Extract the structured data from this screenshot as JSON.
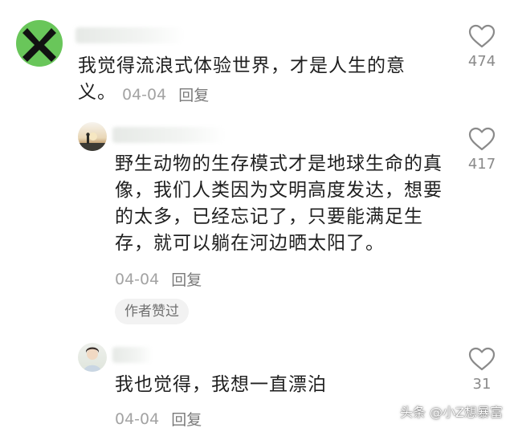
{
  "comments": [
    {
      "text": "我觉得流浪式体验世界，才是人生的意义。",
      "date": "04-04",
      "reply_label": "回复",
      "likes": "474",
      "avatar_icon": "x-logo-avatar"
    },
    {
      "text": "野生动物的生存模式才是地球生命的真像，我们人类因为文明高度发达，想要的太多，已经忘记了，只要能满足生存，就可以躺在河边晒太阳了。",
      "date": "04-04",
      "reply_label": "回复",
      "likes": "417",
      "badge": "作者赞过",
      "avatar_icon": "sunset-avatar"
    },
    {
      "text": "我也觉得，我想一直漂泊",
      "date": "04-04",
      "reply_label": "回复",
      "likes": "31",
      "avatar_icon": "girl-avatar"
    }
  ],
  "watermark": "头条 @小Z想暴富",
  "colors": {
    "text": "#1f1f1f",
    "meta": "#a3a3a3",
    "avatar_green": "#69c65a"
  }
}
